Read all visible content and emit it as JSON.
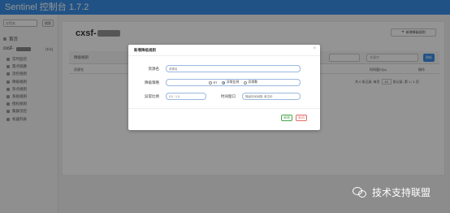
{
  "app": {
    "brand": "Sentinel 控制台 1.7.2"
  },
  "sidebar": {
    "search_placeholder": "应用名",
    "search_button": "搜索",
    "home_label": "首页",
    "app_name": "cxsf-",
    "app_count": "(1/1)",
    "items": [
      {
        "label": "实时监控",
        "icon": "monitor-icon"
      },
      {
        "label": "簇点链路",
        "icon": "link-icon"
      },
      {
        "label": "流控规则",
        "icon": "filter-icon"
      },
      {
        "label": "降级规则",
        "icon": "flash-icon"
      },
      {
        "label": "热点规则",
        "icon": "fire-icon"
      },
      {
        "label": "系统规则",
        "icon": "system-icon"
      },
      {
        "label": "授权规则",
        "icon": "lock-icon"
      },
      {
        "label": "集群流控",
        "icon": "cluster-icon"
      },
      {
        "label": "机器列表",
        "icon": "list-icon"
      }
    ]
  },
  "main": {
    "title": "cxsf-",
    "add_button": "新增降级规则",
    "table_caption": "降级规则",
    "filter_select": "",
    "filter_placeholder": "关键字",
    "filter_button": "刷新",
    "columns": [
      "资源名",
      "降级策略",
      "阈值",
      "时间窗口(s)",
      "操作"
    ],
    "pager": {
      "prefix": "共 0 条记录, 每页",
      "page_size": "10",
      "suffix": "条记录, 第 1 / 1 页"
    }
  },
  "modal": {
    "title": "新增降级规则",
    "close": "×",
    "fields": {
      "resource_label": "资源名",
      "resource_placeholder": "资源名",
      "strategy_label": "降级策略",
      "strategy_options": [
        {
          "label": "RT",
          "selected": false
        },
        {
          "label": "异常比例",
          "selected": true
        },
        {
          "label": "异常数",
          "selected": false
        }
      ],
      "ratio_label": "异常比例",
      "ratio_placeholder": "0.0 - 1.0",
      "window_label": "时间窗口",
      "window_placeholder": "降级时间间隔, 单位秒"
    },
    "add_button": "新增",
    "cancel_button": "取消"
  },
  "watermark": {
    "text": "技术支持联盟"
  },
  "colors": {
    "navbar": "#3a8ee6",
    "primary": "#3a8ee6",
    "success": "#48a54a",
    "danger": "#e26a6a"
  }
}
